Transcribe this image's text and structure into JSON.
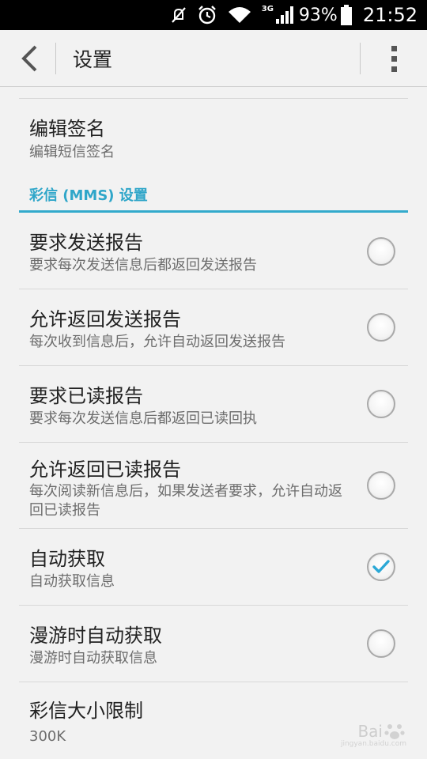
{
  "status_bar": {
    "network": "3G",
    "battery": "93%",
    "time": "21:52",
    "icons": [
      "mute-icon",
      "alarm-icon",
      "wifi-icon",
      "signal-icon",
      "battery-icon"
    ]
  },
  "action_bar": {
    "title": "设置",
    "back_icon": "back-chevron-icon",
    "overflow_icon": "overflow-menu-icon"
  },
  "items": [
    {
      "title": "编辑签名",
      "summary": "编辑短信签名"
    },
    {
      "title": "要求发送报告",
      "summary": "要求每次发送信息后都返回发送报告",
      "checked": false
    },
    {
      "title": "允许返回发送报告",
      "summary": "每次收到信息后，允许自动返回发送报告",
      "checked": false
    },
    {
      "title": "要求已读报告",
      "summary": "要求每次发送信息后都返回已读回执",
      "checked": false
    },
    {
      "title": "允许返回已读报告",
      "summary": "每次阅读新信息后，如果发送者要求，允许自动返回已读报告",
      "checked": false
    },
    {
      "title": "自动获取",
      "summary": "自动获取信息",
      "checked": true
    },
    {
      "title": "漫游时自动获取",
      "summary": "漫游时自动获取信息",
      "checked": false
    },
    {
      "title": "彩信大小限制",
      "summary": "300K"
    }
  ],
  "section_header": "彩信 (MMS) 设置",
  "colors": {
    "accent": "#2fa6c9",
    "check": "#2ba8d6"
  },
  "watermark": {
    "text": "Bai",
    "sub": "jingyan.baidu.com"
  }
}
